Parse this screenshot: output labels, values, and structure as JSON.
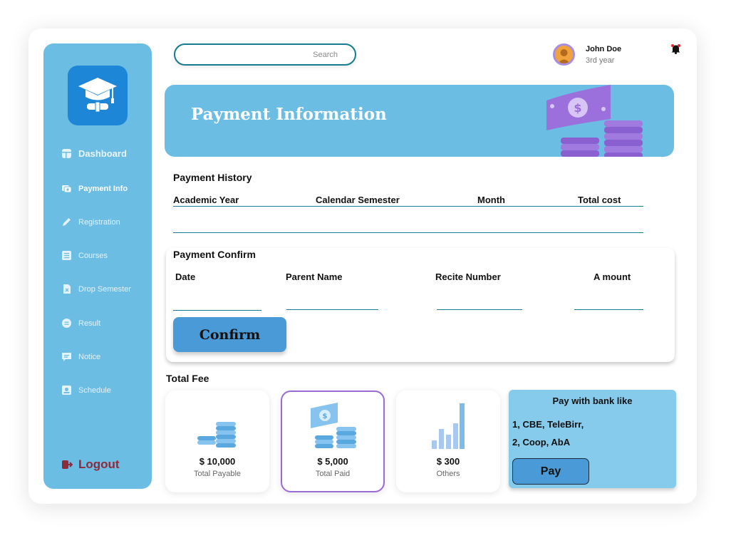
{
  "header": {
    "search_placeholder": "Search",
    "user_name": "John Doe",
    "user_year": "3rd year"
  },
  "sidebar": {
    "items": [
      {
        "label": "Dashboard",
        "icon": "dashboard-icon"
      },
      {
        "label": "Payment Info",
        "icon": "payment-icon"
      },
      {
        "label": "Registration",
        "icon": "pencil-icon"
      },
      {
        "label": "Courses",
        "icon": "courses-icon"
      },
      {
        "label": "Drop Semester",
        "icon": "drop-file-icon"
      },
      {
        "label": "Result",
        "icon": "result-icon"
      },
      {
        "label": "Notice",
        "icon": "notice-icon"
      },
      {
        "label": "Schedule",
        "icon": "schedule-icon"
      }
    ],
    "logout_label": "Logout",
    "active_item": "Payment Info"
  },
  "banner": {
    "title": "Payment Information"
  },
  "payment_history": {
    "title": "Payment History",
    "columns": [
      "Academic Year",
      "Calendar Semester",
      "Month",
      "Total cost"
    ]
  },
  "payment_confirm": {
    "title": "Payment Confirm",
    "fields": [
      "Date",
      "Parent Name",
      "Recite Number",
      "A mount"
    ],
    "confirm_label": "Confirm"
  },
  "total_fee": {
    "title": "Total Fee",
    "cards": [
      {
        "amount": "$ 10,000",
        "label": "Total Payable"
      },
      {
        "amount": "$ 5,000",
        "label": "Total Paid"
      },
      {
        "amount": "$ 300",
        "label": "Others"
      }
    ]
  },
  "bank": {
    "title": "Pay with bank like",
    "line1": "1, CBE, TeleBirr,",
    "line2": "2, Coop, AbA",
    "pay_label": "Pay"
  },
  "colors": {
    "sidebar": "#6cbde3",
    "accent_blue": "#4a9ad8",
    "teal_line": "#137c8e",
    "selected_border": "#9a6ad6",
    "logout": "#8b2b3b"
  }
}
